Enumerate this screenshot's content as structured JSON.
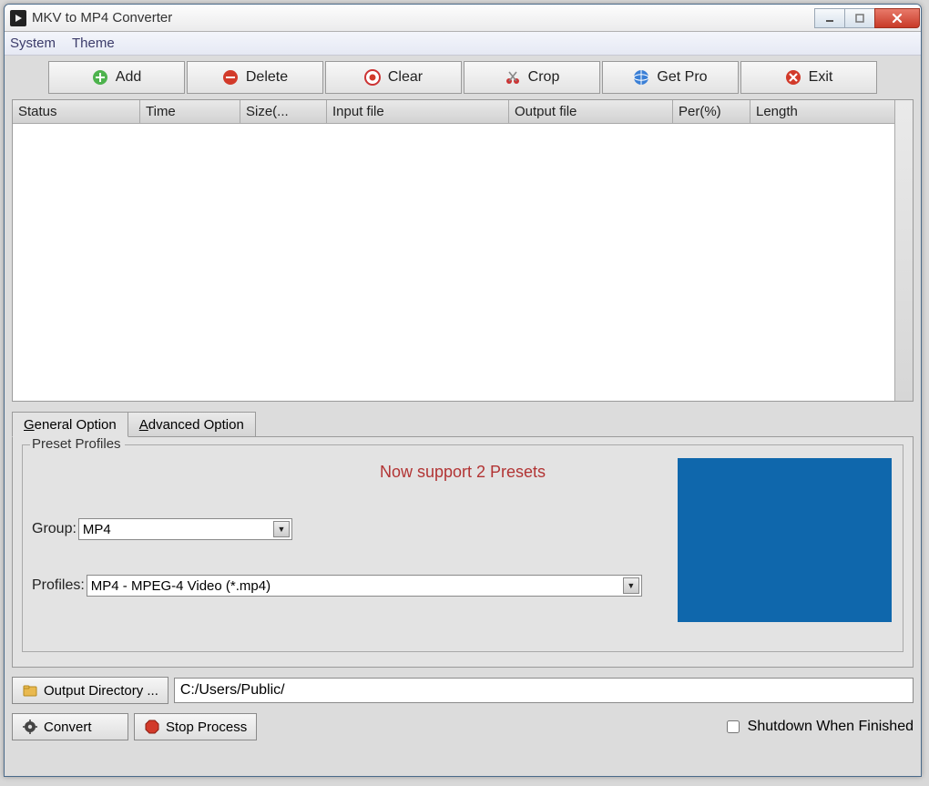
{
  "window": {
    "title": "MKV to MP4 Converter"
  },
  "menu": {
    "system": "System",
    "theme": "Theme"
  },
  "toolbar": {
    "add": "Add",
    "delete": "Delete",
    "clear": "Clear",
    "crop": "Crop",
    "getpro": "Get Pro",
    "exit": "Exit"
  },
  "columns": {
    "status": "Status",
    "time": "Time",
    "size": "Size(...",
    "input": "Input file",
    "output": "Output file",
    "per": "Per(%)",
    "length": "Length"
  },
  "tabs": {
    "general_prefix": "G",
    "general_rest": "eneral Option",
    "advanced_prefix": "A",
    "advanced_rest": "dvanced Option"
  },
  "preset": {
    "legend": "Preset Profiles",
    "message": "Now support 2 Presets",
    "group_label": "Group:",
    "group_value": "MP4",
    "profiles_label": "Profiles:",
    "profiles_value": "MP4 - MPEG-4 Video (*.mp4)"
  },
  "output": {
    "button": "Output Directory ...",
    "path": "C:/Users/Public/"
  },
  "footer": {
    "convert": "Convert",
    "stop": "Stop Process",
    "shutdown": "Shutdown When Finished"
  }
}
